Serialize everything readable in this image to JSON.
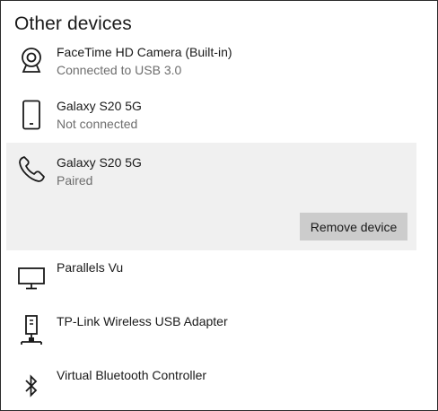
{
  "section": {
    "title": "Other devices"
  },
  "devices": [
    {
      "name": "FaceTime HD Camera (Built-in)",
      "status": "Connected to USB 3.0",
      "icon": "webcam-icon"
    },
    {
      "name": "Galaxy S20 5G",
      "status": "Not connected",
      "icon": "phone-icon"
    },
    {
      "name": "Galaxy S20 5G",
      "status": "Paired",
      "icon": "phone-handset-icon",
      "selected": true
    },
    {
      "name": "Parallels Vu",
      "status": "",
      "icon": "monitor-icon"
    },
    {
      "name": "TP-Link Wireless USB Adapter",
      "status": "",
      "icon": "network-adapter-icon"
    },
    {
      "name": "Virtual Bluetooth Controller",
      "status": "",
      "icon": "bluetooth-icon"
    }
  ],
  "actions": {
    "remove_device_label": "Remove device"
  },
  "colors": {
    "selected_bg": "#f0f0f0",
    "button_bg": "#cccccc",
    "secondary_text": "#6e6e6e"
  }
}
